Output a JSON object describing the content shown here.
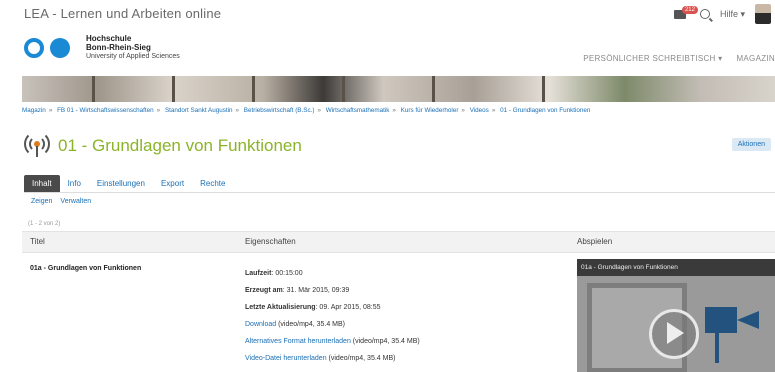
{
  "app_title": "LEA - Lernen und Arbeiten online",
  "top_right": {
    "notification_count": "212",
    "help_label": "Hilfe",
    "icons": [
      "mail-icon",
      "search-icon",
      "avatar"
    ]
  },
  "logo": {
    "line1": "Hochschule",
    "line2": "Bonn-Rhein-Sieg",
    "line3": "University of Applied Sciences"
  },
  "mainnav": [
    "PERSÖNLICHER SCHREIBTISCH ▾",
    "MAGAZIN"
  ],
  "breadcrumb": [
    "Magazin",
    "FB 01 - Wirtschaftswissenschaften",
    "Standort Sankt Augustin",
    "Betriebswirtschaft (B.Sc.)",
    "Wirtschaftsmathematik",
    "Kurs für Wiederholer",
    "Videos",
    "01 - Grundlagen von Funktionen"
  ],
  "page_title": "01 - Grundlagen von Funktionen",
  "actions_label": "Aktionen",
  "tabs": [
    "Inhalt",
    "Info",
    "Einstellungen",
    "Export",
    "Rechte"
  ],
  "subtabs": [
    "Zeigen",
    "Verwalten"
  ],
  "count_text": "(1 - 2 von 2)",
  "table": {
    "headers": [
      "Titel",
      "Eigenschaften",
      "Abspielen"
    ],
    "row": {
      "title": "01a - Grundlagen von Funktionen",
      "laufzeit_label": "Laufzeit",
      "laufzeit": ": 00:15:00",
      "erzeugt_label": "Erzeugt am",
      "erzeugt": ": 31. Mär 2015, 09:39",
      "aktual_label": "Letzte Aktualisierung",
      "aktual": ": 09. Apr 2015, 08:55",
      "download_link": "Download",
      "download_info": " (video/mp4, 35.4 MB)",
      "alt_link": "Alternatives Format herunterladen",
      "alt_info": " (video/mp4, 35.4 MB)",
      "video_link": "Video-Datei herunterladen",
      "video_info": " (video/mp4, 35.4 MB)",
      "player_title": "01a - Grundlagen von Funktionen"
    }
  },
  "colors": {
    "accent_green": "#8bb42a",
    "link_blue": "#1a6fb5",
    "logo_blue": "#1a8ad4"
  }
}
